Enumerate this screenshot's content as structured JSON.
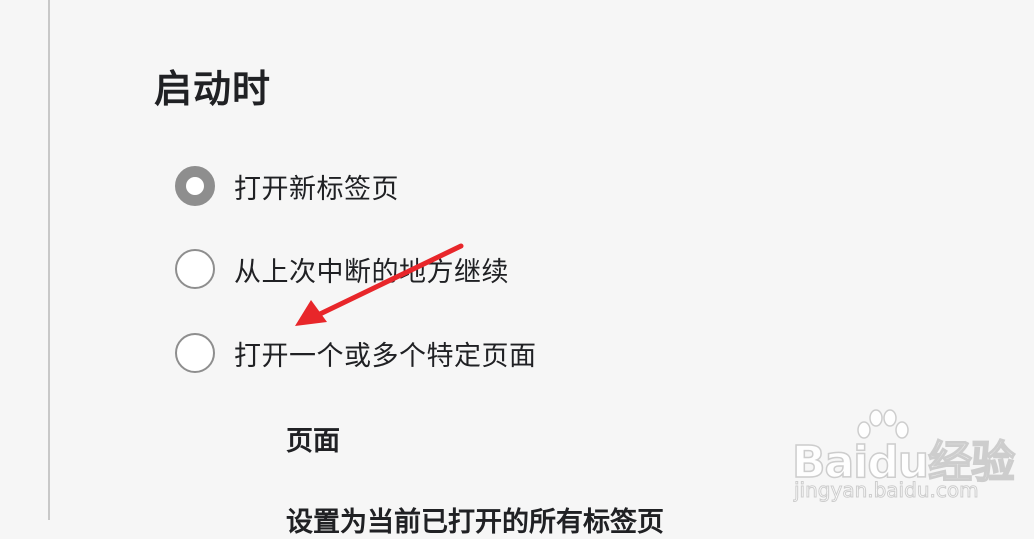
{
  "section": {
    "title": "启动时"
  },
  "startup_options": [
    {
      "label": "打开新标签页",
      "checked": true
    },
    {
      "label": "从上次中断的地方继续",
      "checked": false
    },
    {
      "label": "打开一个或多个特定页面",
      "checked": false
    }
  ],
  "specific_pages": {
    "heading": "页面",
    "use_current_label": "设置为当前已打开的所有标签页"
  },
  "annotation": {
    "arrow_color": "#e8262a",
    "arrow_target": "打开一个或多个特定页面"
  },
  "watermark": {
    "brand": "Bai",
    "brand_suffix": "du",
    "product": "经验",
    "url": "jingyan.baidu.com"
  },
  "colors": {
    "background": "#f6f6f6",
    "radio_border": "#8e8e8e",
    "text": "#202124"
  }
}
